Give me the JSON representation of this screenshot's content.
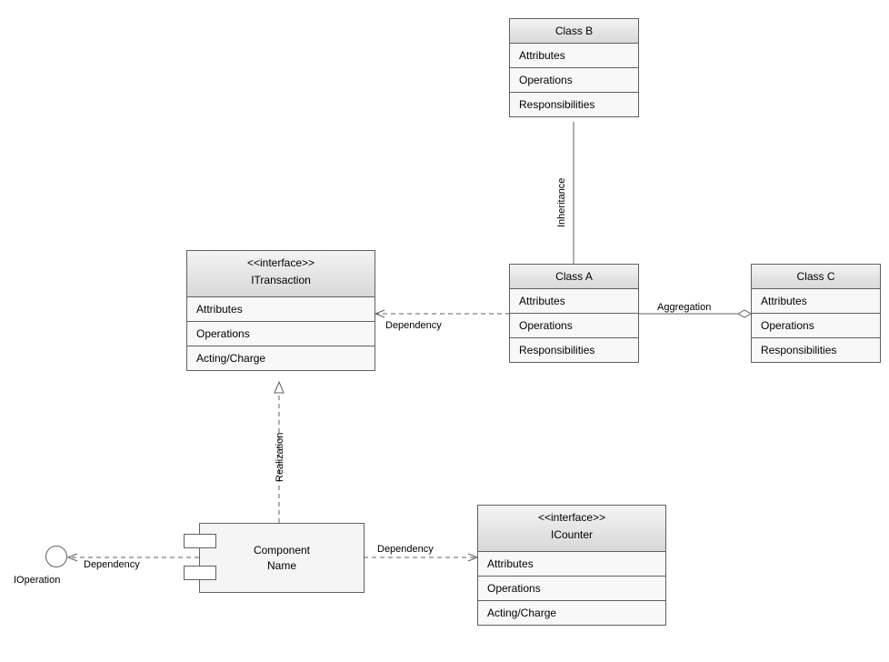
{
  "classB": {
    "name": "Class B",
    "attributes": "Attributes",
    "operations": "Operations",
    "responsibilities": "Responsibilities"
  },
  "classA": {
    "name": "Class A",
    "attributes": "Attributes",
    "operations": "Operations",
    "responsibilities": "Responsibilities"
  },
  "classC": {
    "name": "Class C",
    "attributes": "Attributes",
    "operations": "Operations",
    "responsibilities": "Responsibilities"
  },
  "itransaction": {
    "stereotype": "<<interface>>",
    "name": "ITransaction",
    "attributes": "Attributes",
    "operations": "Operations",
    "acting": "Acting/Charge"
  },
  "icounter": {
    "stereotype": "<<interface>>",
    "name": "ICounter",
    "attributes": "Attributes",
    "operations": "Operations",
    "acting": "Acting/Charge"
  },
  "component": {
    "name": "Component\nName"
  },
  "ioperation": {
    "name": "IOperation"
  },
  "labels": {
    "inheritance": "Inheritance",
    "aggregation": "Aggregation",
    "dependency": "Dependency",
    "realization": "Realization"
  }
}
